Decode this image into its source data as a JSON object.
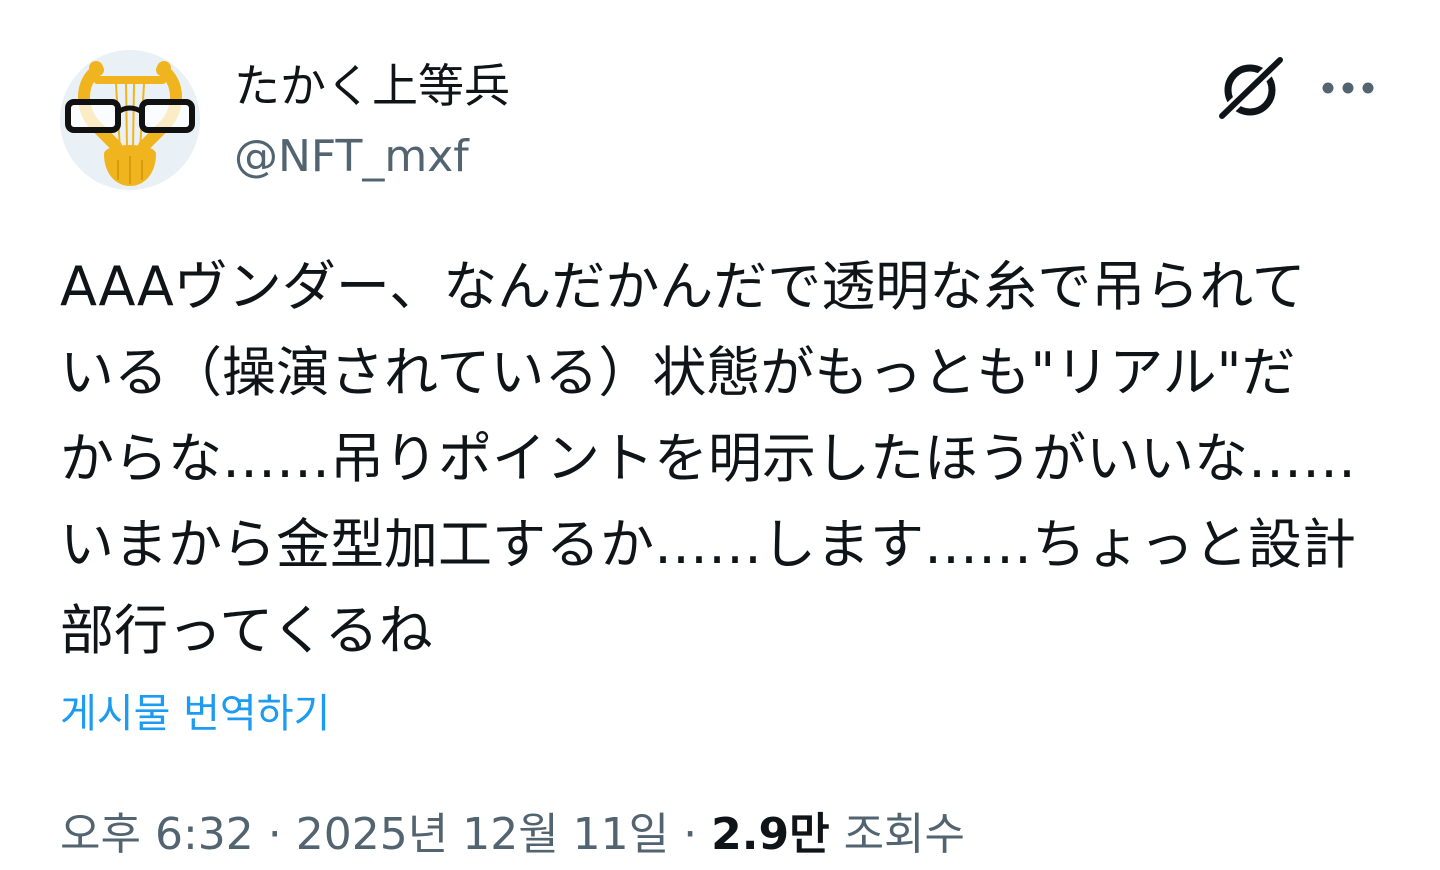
{
  "author": {
    "display_name": "たかく上等兵",
    "handle": "@NFT_mxf",
    "avatar_icon": "lyre-glasses-avatar"
  },
  "header_icons": {
    "grok": "grok-icon",
    "more": "more-dots-icon"
  },
  "tweet": {
    "lines": [
      "AAAヴンダー、なんだかんだで透明な糸で吊られて",
      "いる（操演されている）状態がもっとも\"リアル\"だ",
      "からな……吊りポイントを明示したほうがいいな……",
      "いまから金型加工するか……します……ちょっと設計",
      "部行ってくるね"
    ]
  },
  "translate_label": "게시물 번역하기",
  "meta": {
    "time": "오후 6:32",
    "separator": "·",
    "date": "2025년 12월 11일",
    "views_count": "2.9만",
    "views_label": "조회수"
  },
  "colors": {
    "link": "#1d9bf0",
    "secondary_text": "#536471",
    "primary_text": "#0f1419",
    "avatar_gold": "#f0b51e",
    "avatar_bg": "#e9f1f7"
  }
}
